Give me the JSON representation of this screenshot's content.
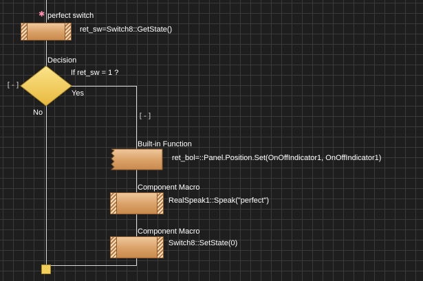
{
  "flowchart": {
    "start_label": "perfect switch",
    "calc_text": "ret_sw=Switch8::GetState()",
    "decision": {
      "title": "Decision",
      "condition": "If  ret_sw = 1 ?",
      "yes_label": "Yes",
      "no_label": "No",
      "collapse_label": "[-]"
    },
    "yes_branch_collapse": "[-]",
    "builtin": {
      "title": "Built-in Function",
      "text": "ret_bol=::Panel.Position.Set(OnOffIndicator1, OnOffIndicator1)"
    },
    "macro1": {
      "title": "Component Macro",
      "text": "RealSpeak1::Speak(\"perfect\")"
    },
    "macro2": {
      "title": "Component Macro",
      "text": "Switch8::SetState(0)"
    }
  },
  "colors": {
    "background": "#1e1e1e",
    "grid": "#3a3a3a",
    "connector": "#d8d8d8",
    "block_fill": "#d9a066",
    "decision_fill": "#f2cf5b",
    "start_star": "#ff8fb0"
  }
}
